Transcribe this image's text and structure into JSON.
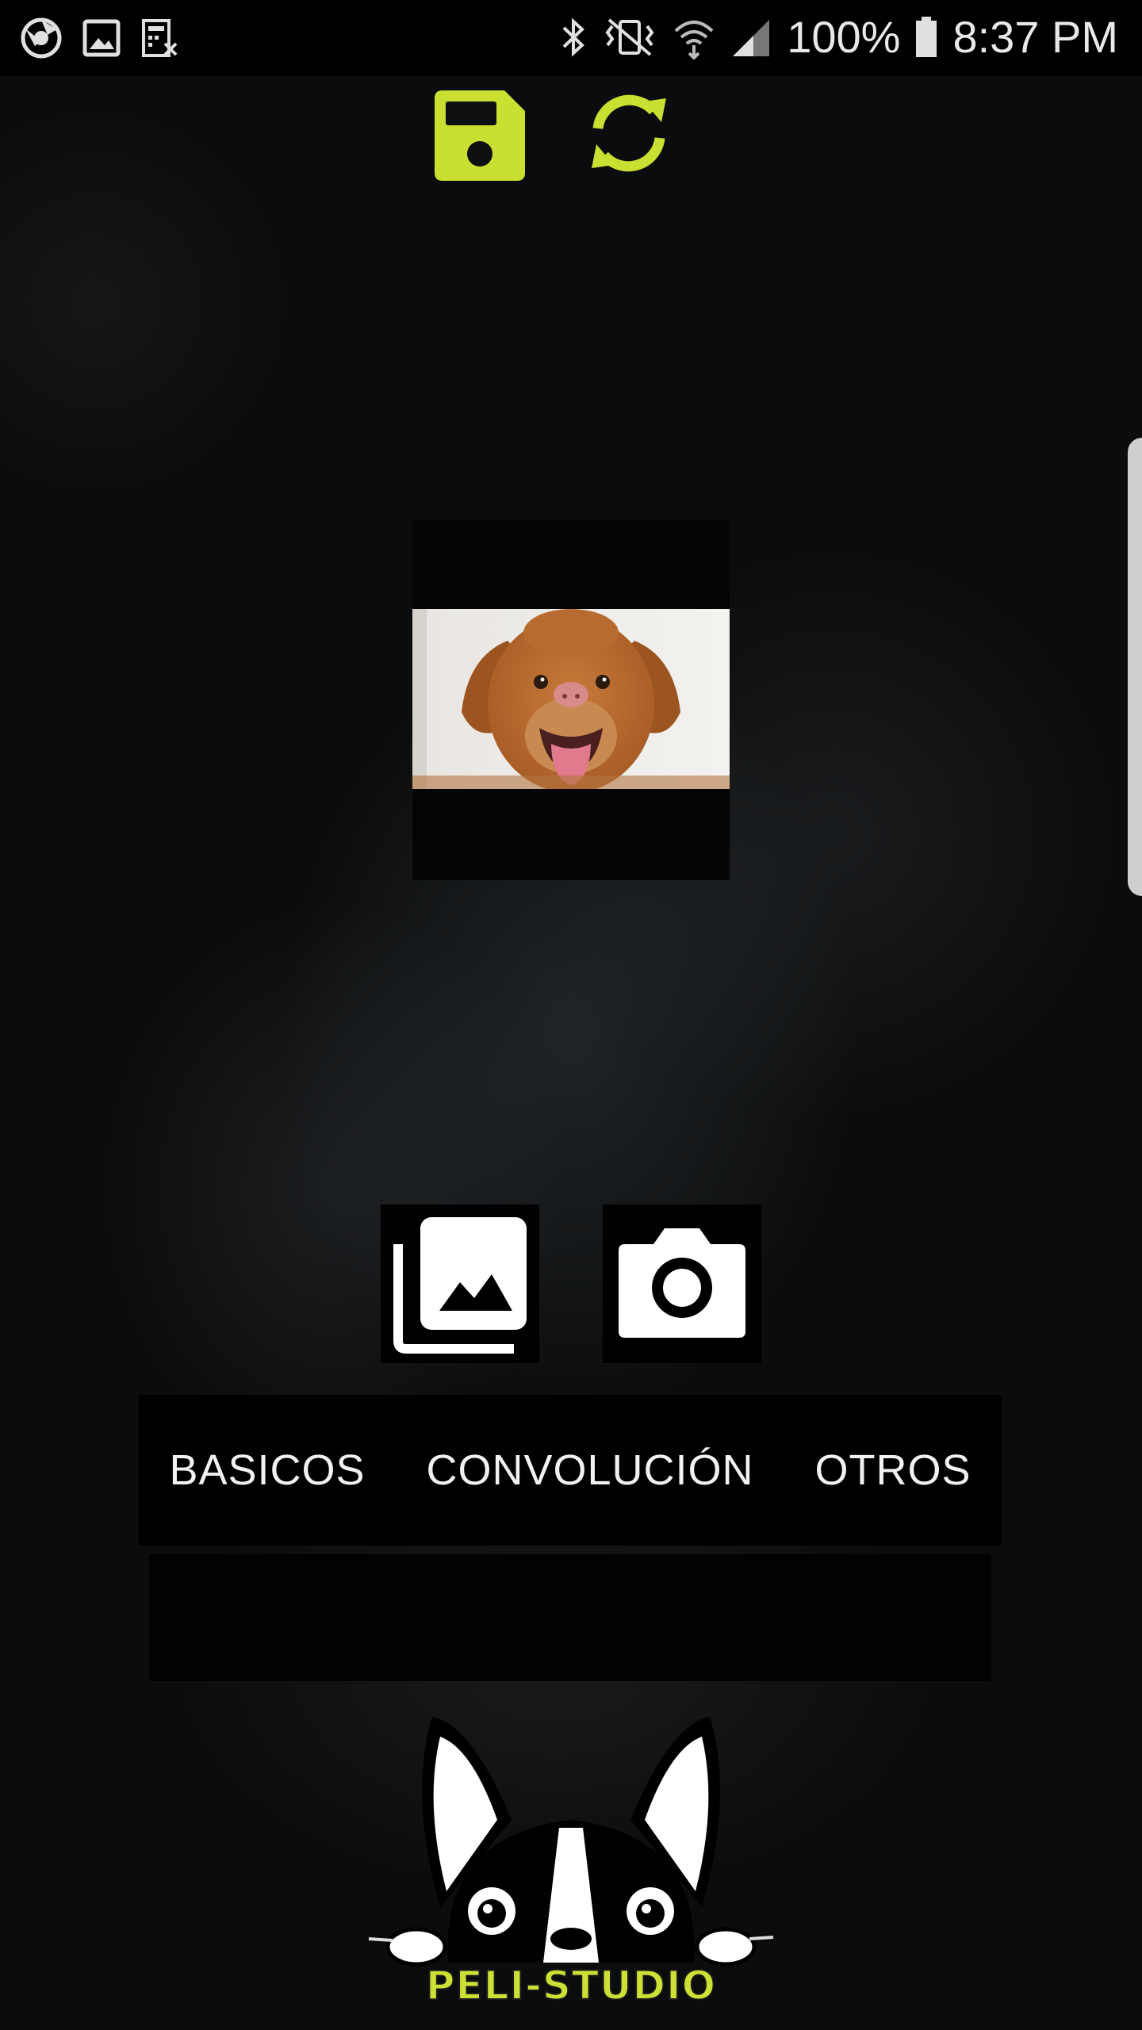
{
  "status_bar": {
    "battery": "100%",
    "time": "8:37 PM",
    "left_icons": [
      "chrome-icon",
      "image-notification-icon",
      "calculator-icon"
    ],
    "right_icons": [
      "bluetooth-icon",
      "vibrate-icon",
      "wifi-icon",
      "signal-icon",
      "battery-icon"
    ]
  },
  "toolbar": {
    "save_icon": "floppy-save-icon",
    "refresh_icon": "sync-icon",
    "accent_color": "#c9df31"
  },
  "preview": {
    "image_icon": "dog-photo"
  },
  "actions": {
    "gallery_icon": "gallery-icon",
    "camera_icon": "camera-icon"
  },
  "tabs": [
    {
      "label": "BASICOS"
    },
    {
      "label": "CONVOLUCIÓN"
    },
    {
      "label": "OTROS"
    }
  ],
  "logo": {
    "text": "PELI-STUDIO",
    "text_color": "#cde036"
  }
}
